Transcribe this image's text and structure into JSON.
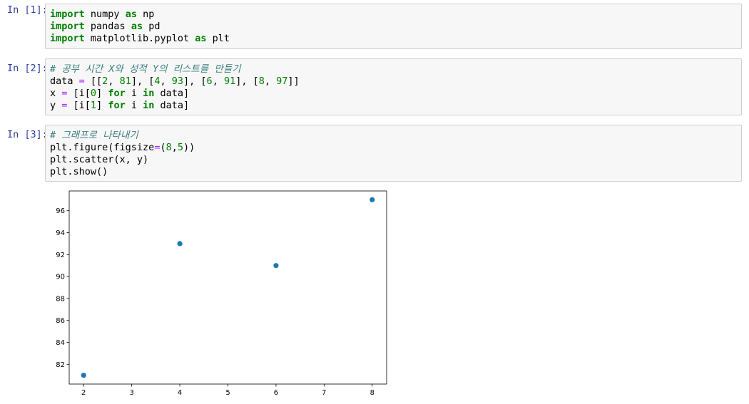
{
  "cells": [
    {
      "prompt": "In [1]:",
      "lines": [
        [
          {
            "t": "import",
            "c": "kw"
          },
          {
            "t": " numpy ",
            "c": ""
          },
          {
            "t": "as",
            "c": "kw"
          },
          {
            "t": " np",
            "c": ""
          }
        ],
        [
          {
            "t": "import",
            "c": "kw"
          },
          {
            "t": " pandas ",
            "c": ""
          },
          {
            "t": "as",
            "c": "kw"
          },
          {
            "t": " pd",
            "c": ""
          }
        ],
        [
          {
            "t": "import",
            "c": "kw"
          },
          {
            "t": " matplotlib.pyplot ",
            "c": ""
          },
          {
            "t": "as",
            "c": "kw"
          },
          {
            "t": " plt",
            "c": ""
          }
        ]
      ]
    },
    {
      "prompt": "In [2]:",
      "lines": [
        [
          {
            "t": "# 공부 시간 X와 성적 Y의 리스트를 만들기",
            "c": "cm"
          }
        ],
        [
          {
            "t": "data ",
            "c": ""
          },
          {
            "t": "=",
            "c": "op"
          },
          {
            "t": " [[",
            "c": ""
          },
          {
            "t": "2",
            "c": "num"
          },
          {
            "t": ", ",
            "c": ""
          },
          {
            "t": "81",
            "c": "num"
          },
          {
            "t": "], [",
            "c": ""
          },
          {
            "t": "4",
            "c": "num"
          },
          {
            "t": ", ",
            "c": ""
          },
          {
            "t": "93",
            "c": "num"
          },
          {
            "t": "], [",
            "c": ""
          },
          {
            "t": "6",
            "c": "num"
          },
          {
            "t": ", ",
            "c": ""
          },
          {
            "t": "91",
            "c": "num"
          },
          {
            "t": "], [",
            "c": ""
          },
          {
            "t": "8",
            "c": "num"
          },
          {
            "t": ", ",
            "c": ""
          },
          {
            "t": "97",
            "c": "num"
          },
          {
            "t": "]]",
            "c": ""
          }
        ],
        [
          {
            "t": "x ",
            "c": ""
          },
          {
            "t": "=",
            "c": "op"
          },
          {
            "t": " [i[",
            "c": ""
          },
          {
            "t": "0",
            "c": "num"
          },
          {
            "t": "] ",
            "c": ""
          },
          {
            "t": "for",
            "c": "kw"
          },
          {
            "t": " i ",
            "c": ""
          },
          {
            "t": "in",
            "c": "kw"
          },
          {
            "t": " data]",
            "c": ""
          }
        ],
        [
          {
            "t": "y ",
            "c": ""
          },
          {
            "t": "=",
            "c": "op"
          },
          {
            "t": " [i[",
            "c": ""
          },
          {
            "t": "1",
            "c": "num"
          },
          {
            "t": "] ",
            "c": ""
          },
          {
            "t": "for",
            "c": "kw"
          },
          {
            "t": " i ",
            "c": ""
          },
          {
            "t": "in",
            "c": "kw"
          },
          {
            "t": " data]",
            "c": ""
          }
        ]
      ]
    },
    {
      "prompt": "In [3]:",
      "lines": [
        [
          {
            "t": "# 그래프로 나타내기",
            "c": "cm"
          }
        ],
        [
          {
            "t": "plt.figure(figsize",
            "c": ""
          },
          {
            "t": "=",
            "c": "op"
          },
          {
            "t": "(",
            "c": ""
          },
          {
            "t": "8",
            "c": "num"
          },
          {
            "t": ",",
            "c": ""
          },
          {
            "t": "5",
            "c": "num"
          },
          {
            "t": "))",
            "c": ""
          }
        ],
        [
          {
            "t": "plt.scatter(x, y)",
            "c": ""
          }
        ],
        [
          {
            "t": "plt.show()",
            "c": ""
          }
        ]
      ]
    }
  ],
  "colors": {
    "prompt": "#303f9f",
    "keyword": "#008000",
    "comment": "#408080",
    "operator": "#aa22ff",
    "marker": "#1f77b4"
  },
  "chart_data": {
    "type": "scatter",
    "title": "",
    "xlabel": "",
    "ylabel": "",
    "x": [
      2,
      4,
      6,
      8
    ],
    "y": [
      81,
      93,
      91,
      97
    ],
    "xlim": [
      1.7,
      8.3
    ],
    "ylim": [
      80.2,
      97.8
    ],
    "xticks": [
      2,
      3,
      4,
      5,
      6,
      7,
      8
    ],
    "yticks": [
      82,
      84,
      86,
      88,
      90,
      92,
      94,
      96
    ],
    "grid": false
  }
}
